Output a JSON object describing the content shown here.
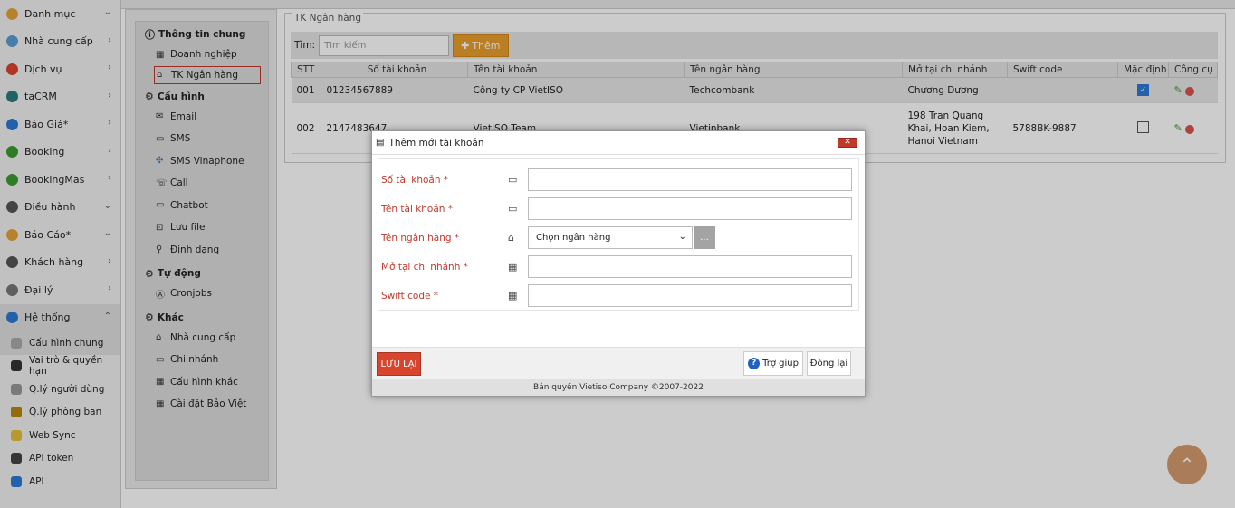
{
  "sidebar": {
    "items": [
      {
        "label": "Danh mục",
        "icon": "layers-icon",
        "color": "#e5a33a",
        "arrow": "⌄"
      },
      {
        "label": "Nhà cung cấp",
        "icon": "supplier-icon",
        "color": "#5b9bd5",
        "arrow": "›"
      },
      {
        "label": "Dịch vụ",
        "icon": "service-icon",
        "color": "#d9442d",
        "arrow": "›"
      },
      {
        "label": "taCRM",
        "icon": "crm-icon",
        "color": "#2a7b7b",
        "arrow": "›"
      },
      {
        "label": "Báo Giá*",
        "icon": "quote-icon",
        "color": "#2d7ad6",
        "arrow": "›"
      },
      {
        "label": "Booking",
        "icon": "booking-icon",
        "color": "#3a9b2f",
        "arrow": "›"
      },
      {
        "label": "BookingMas",
        "icon": "bookingmas-icon",
        "color": "#3a9b2f",
        "arrow": "›"
      },
      {
        "label": "Điều hành",
        "icon": "operate-icon",
        "color": "#555",
        "arrow": "⌄"
      },
      {
        "label": "Báo Cáo*",
        "icon": "report-icon",
        "color": "#e5a33a",
        "arrow": "⌄"
      },
      {
        "label": "Khách hàng",
        "icon": "customer-icon",
        "color": "#555",
        "arrow": "›"
      },
      {
        "label": "Đại lý",
        "icon": "agent-icon",
        "color": "#777",
        "arrow": "›"
      },
      {
        "label": "Hệ thống",
        "icon": "system-gear-icon",
        "color": "#2d7ad6",
        "arrow": "⌃"
      }
    ],
    "subitems": [
      {
        "label": "Cấu hình chung",
        "icon": "config-icon",
        "color": "#aaa"
      },
      {
        "label": "Vai trò & quyền hạn",
        "icon": "role-icon",
        "color": "#333"
      },
      {
        "label": "Q.lý người dùng",
        "icon": "user-manage-icon",
        "color": "#999"
      },
      {
        "label": "Q.lý phòng ban",
        "icon": "department-icon",
        "color": "#b8860b"
      },
      {
        "label": "Web Sync",
        "icon": "websync-icon",
        "color": "#e5c03a"
      },
      {
        "label": "API token",
        "icon": "api-token-icon",
        "color": "#444"
      },
      {
        "label": "API",
        "icon": "api-icon",
        "color": "#2d7ad6"
      }
    ]
  },
  "settings_nav": {
    "general": {
      "title": "Thông tin chung",
      "items": [
        "Doanh nghiệp",
        "TK Ngân hàng"
      ]
    },
    "config": {
      "title": "Cấu hình",
      "items": [
        "Email",
        "SMS",
        "SMS Vinaphone",
        "Call",
        "Chatbot",
        "Lưu file",
        "Định dạng"
      ]
    },
    "auto": {
      "title": "Tự động",
      "items": [
        "Cronjobs"
      ]
    },
    "other": {
      "title": "Khác",
      "items": [
        "Nhà cung cấp",
        "Chi nhánh",
        "Cấu hình khác",
        "Cài đặt Bảo Việt"
      ]
    }
  },
  "main": {
    "section_title": "TK Ngân hàng",
    "search_label": "Tìm:",
    "search_placeholder": "Tìm kiếm",
    "add_button": "Thêm",
    "columns": [
      "STT",
      "Số tài khoản",
      "Tên tài khoản",
      "Tên ngân hàng",
      "Mở tại chi nhánh",
      "Swift code",
      "Mặc định",
      "Công cụ"
    ],
    "rows": [
      {
        "stt": "001",
        "account": "01234567889",
        "name": "Công ty CP VietISO",
        "bank": "Techcombank",
        "branch": "Chương Dương",
        "swift": "",
        "default": true
      },
      {
        "stt": "002",
        "account": "2147483647",
        "name": "VietISO Team",
        "bank": "Vietinbank",
        "branch": "198 Tran Quang Khai, Hoan Kiem, Hanoi Vietnam",
        "swift": "5788BK-9887",
        "default": false
      }
    ]
  },
  "modal": {
    "title": "Thêm mới tài khoản",
    "fields": [
      {
        "label": "Số tài khoản *",
        "icon": "card-icon",
        "value": ""
      },
      {
        "label": "Tên tài khoản *",
        "icon": "contact-card-icon",
        "value": ""
      },
      {
        "label": "Tên ngân hàng *",
        "icon": "bank-icon",
        "value": "Chọn ngân hàng"
      },
      {
        "label": "Mở tại chi nhánh *",
        "icon": "building-icon",
        "value": ""
      },
      {
        "label": "Swift code *",
        "icon": "building-icon",
        "value": ""
      }
    ],
    "more_button": "...",
    "save_button": "LƯU LẠI",
    "help_button": "Trợ giúp",
    "close_button": "Đóng lại",
    "copyright": "Bản quyền Vietiso Company ©2007-2022"
  }
}
